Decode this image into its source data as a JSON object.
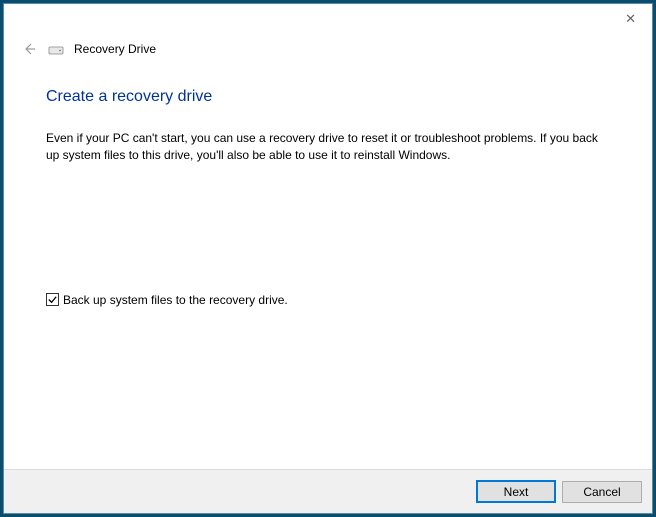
{
  "header": {
    "window_title": "Recovery Drive"
  },
  "main": {
    "heading": "Create a recovery drive",
    "description": "Even if your PC can't start, you can use a recovery drive to reset it or troubleshoot problems. If you back up system files to this drive, you'll also be able to use it to reinstall Windows.",
    "checkbox": {
      "label": "Back up system files to the recovery drive.",
      "checked": true
    }
  },
  "footer": {
    "next_label": "Next",
    "cancel_label": "Cancel"
  }
}
